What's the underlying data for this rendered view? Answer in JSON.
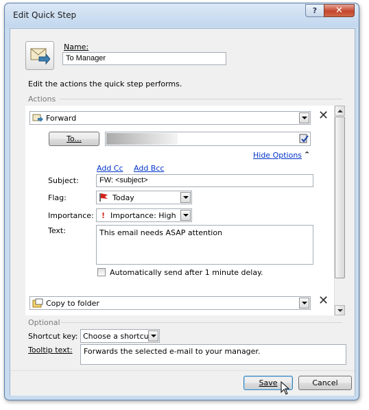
{
  "window": {
    "title": "Edit Quick Step",
    "help_glyph": "?",
    "close_glyph": "✕"
  },
  "name": {
    "label": "Name:",
    "value": "To Manager"
  },
  "intro_text": "Edit the actions the quick step performs.",
  "actions": {
    "section_label": "Actions",
    "first_action": {
      "selected": "Forward",
      "icon": "forward-mail-icon"
    },
    "to_button": "To...",
    "to_value": "",
    "hide_options_link": "Hide Options",
    "add_cc_link": "Add Cc",
    "add_bcc_link": "Add Bcc",
    "subject": {
      "label": "Subject:",
      "value": "FW: <subject>"
    },
    "flag": {
      "label": "Flag:",
      "selected": "Today"
    },
    "importance": {
      "label": "Importance:",
      "selected": "Importance: High"
    },
    "text": {
      "label": "Text:",
      "value": "This email needs ASAP attention"
    },
    "autosend_label": "Automatically send after 1 minute delay.",
    "autosend_checked": false,
    "second_action": {
      "selected": "Copy to folder",
      "icon": "copy-to-folder-icon"
    }
  },
  "optional": {
    "section_label": "Optional",
    "shortcut": {
      "label": "Shortcut key:",
      "selected": "Choose a shortcut"
    },
    "tooltip": {
      "label": "Tooltip text:",
      "value": "Forwards the selected e-mail to your manager."
    }
  },
  "buttons": {
    "save": "Save",
    "cancel": "Cancel"
  },
  "colors": {
    "link": "#0033cc",
    "flag_red": "#d2231b",
    "accent_blue": "#3c7fb1"
  }
}
